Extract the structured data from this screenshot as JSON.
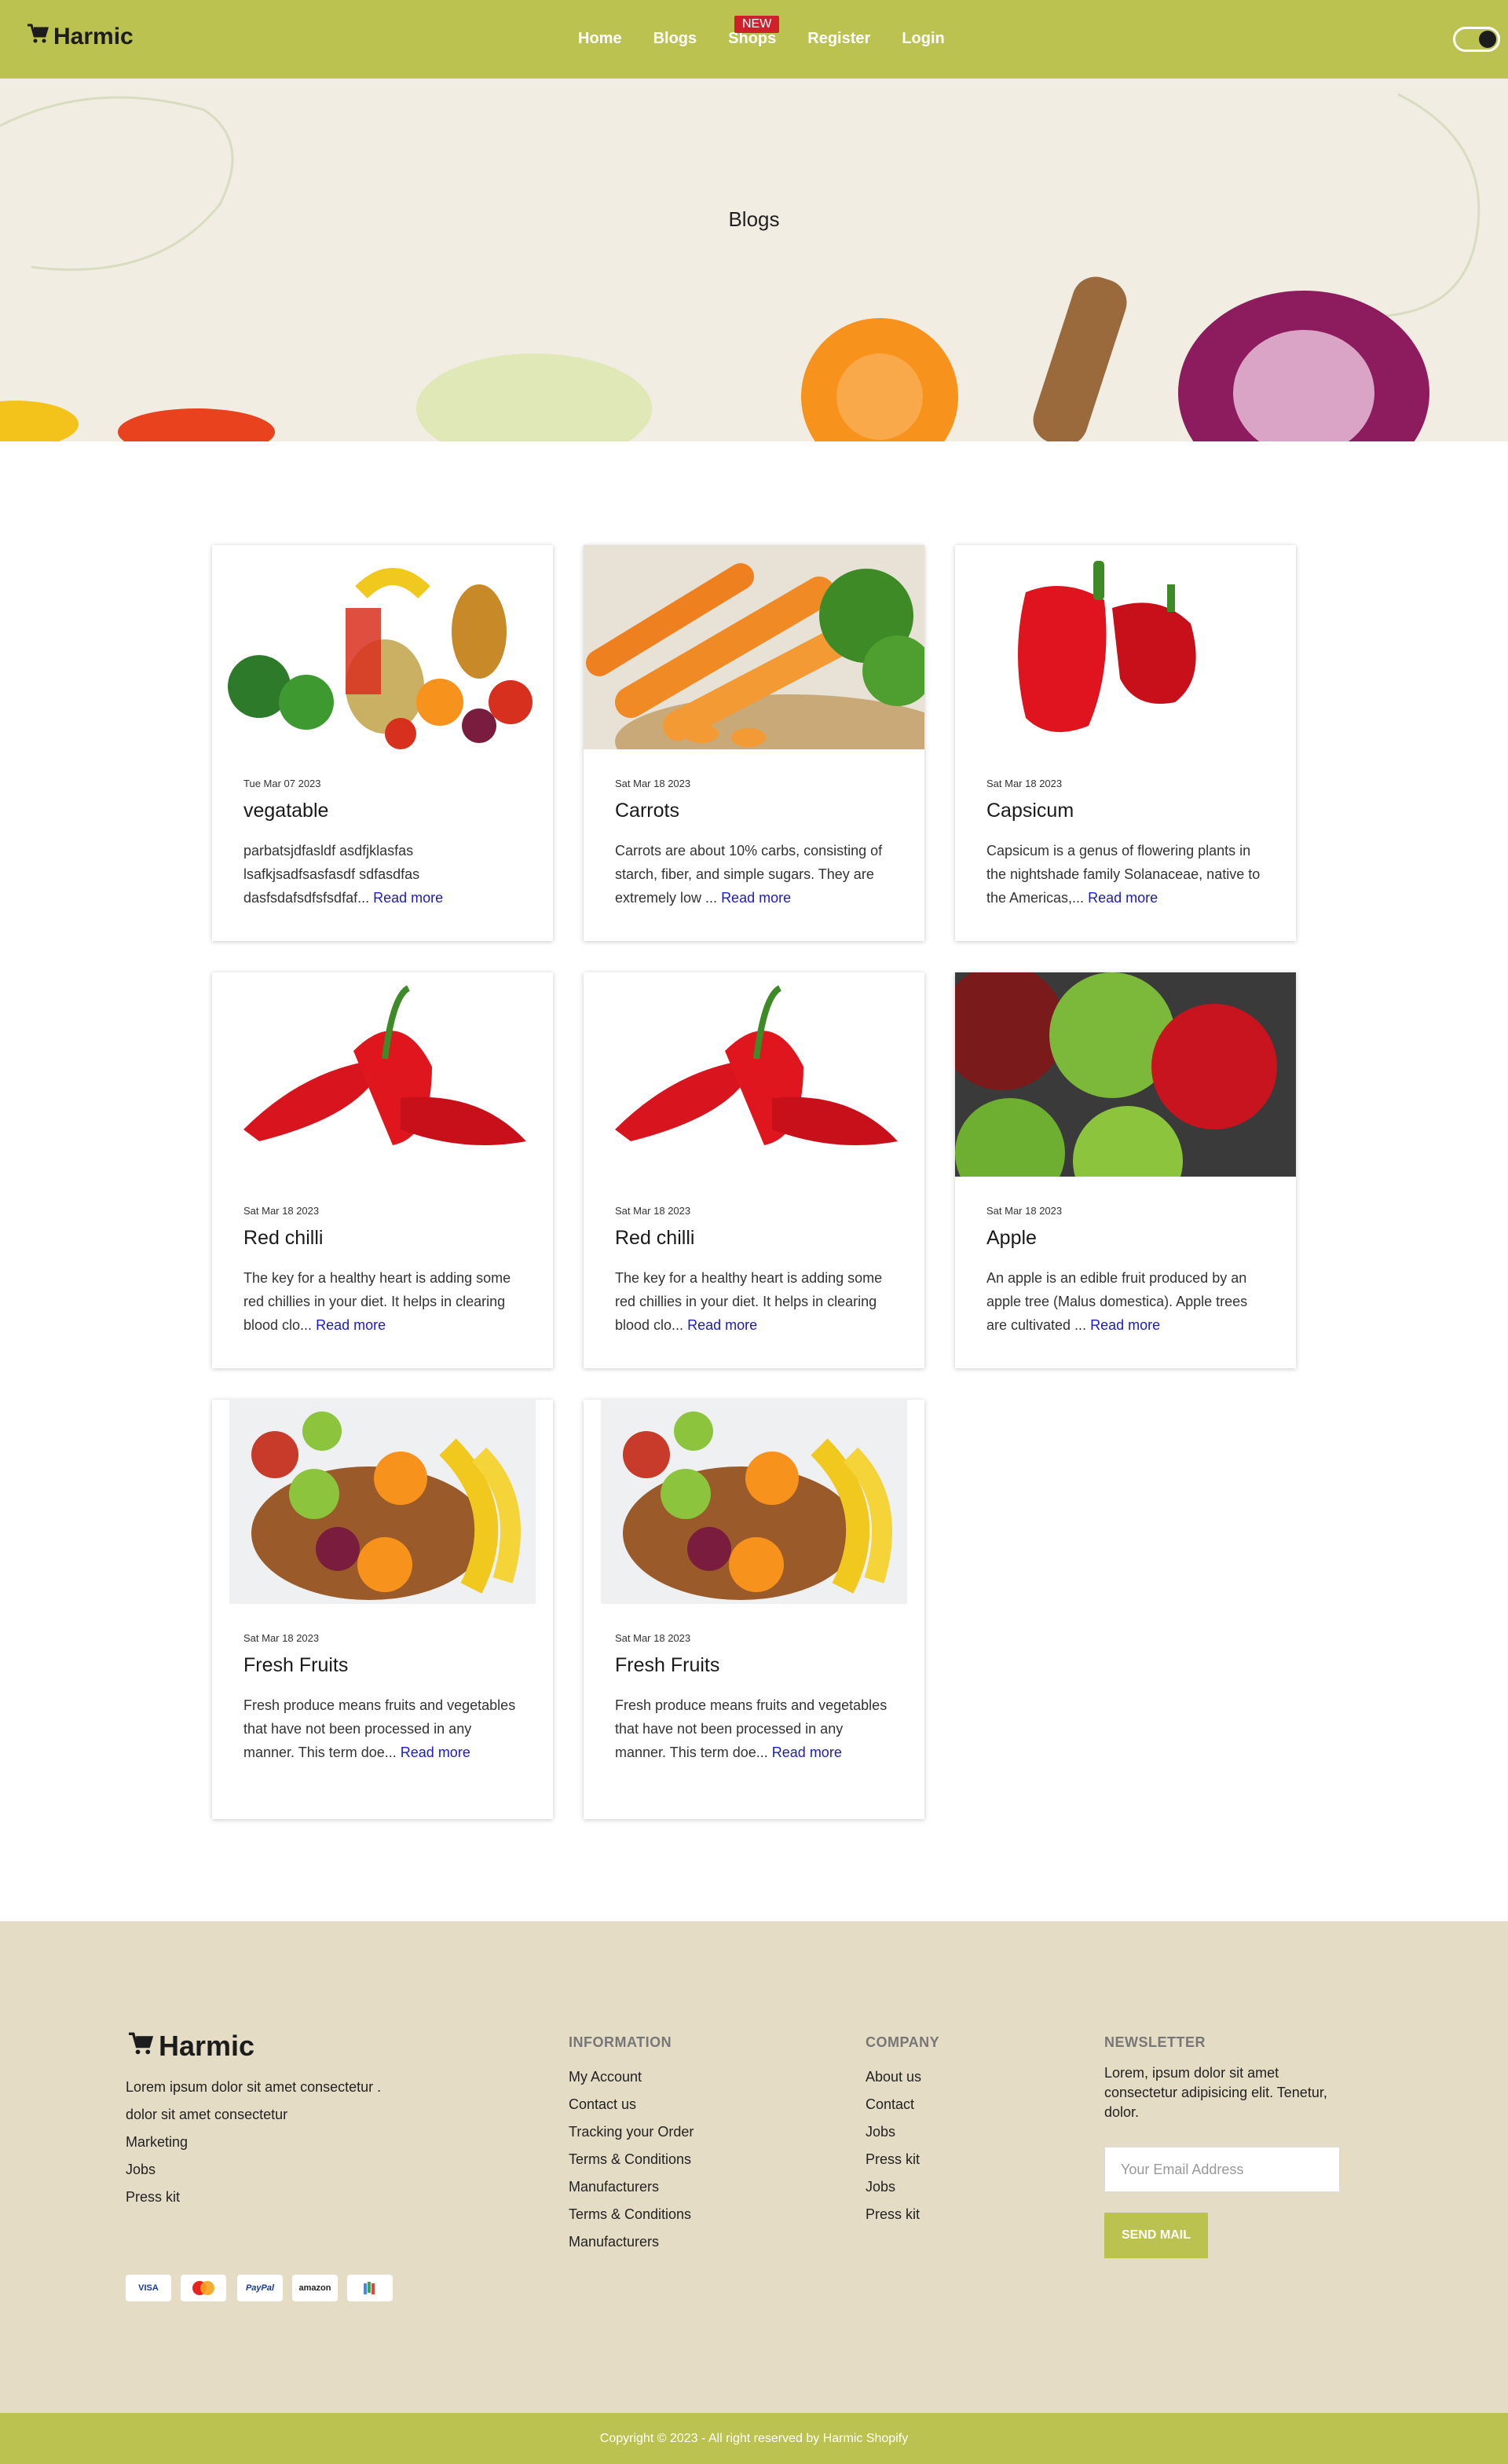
{
  "nav": {
    "brand": "Harmic",
    "links": [
      "Home",
      "Blogs",
      "Shops",
      "Register",
      "Login"
    ],
    "new_badge": "NEW",
    "accent": "#bcc24f"
  },
  "hero": {
    "title": "Blogs"
  },
  "posts": [
    {
      "date": "Tue Mar 07 2023",
      "title": "vegatable",
      "excerpt": "parbatsjdfasldf asdfjklasfas lsafkjsadfsasfasdf sdfasdfas dasfsdafsdfsfsdfaf...",
      "read_more": "Read more"
    },
    {
      "date": "Sat Mar 18 2023",
      "title": "Carrots",
      "excerpt": "Carrots are about 10% carbs, consisting of starch, fiber, and simple sugars. They are extremely low ...",
      "read_more": "Read more"
    },
    {
      "date": "Sat Mar 18 2023",
      "title": "Capsicum",
      "excerpt": "Capsicum is a genus of flowering plants in the nightshade family Solanaceae, native to the Americas,...",
      "read_more": "Read more"
    },
    {
      "date": "Sat Mar 18 2023",
      "title": "Red chilli",
      "excerpt": "The key for a healthy heart is adding some red chillies in your diet. It helps in clearing blood clo...",
      "read_more": "Read more"
    },
    {
      "date": "Sat Mar 18 2023",
      "title": "Red chilli",
      "excerpt": "The key for a healthy heart is adding some red chillies in your diet. It helps in clearing blood clo...",
      "read_more": "Read more"
    },
    {
      "date": "Sat Mar 18 2023",
      "title": "Apple",
      "excerpt": "An apple is an edible fruit produced by an apple tree (Malus domestica). Apple trees are cultivated ...",
      "read_more": "Read more"
    },
    {
      "date": "Sat Mar 18 2023",
      "title": "Fresh Fruits",
      "excerpt": "Fresh produce means fruits and vegetables that have not been processed in any manner. This term doe...",
      "read_more": "Read more"
    },
    {
      "date": "Sat Mar 18 2023",
      "title": "Fresh Fruits",
      "excerpt": "Fresh produce means fruits and vegetables that have not been processed in any manner. This term doe...",
      "read_more": "Read more"
    }
  ],
  "footer": {
    "brand": "Harmic",
    "about": [
      "Lorem ipsum dolor sit amet consectetur .",
      "dolor sit amet consectetur",
      "Marketing",
      "Jobs",
      "Press kit"
    ],
    "information": {
      "heading": "INFORMATION",
      "items": [
        "My Account",
        "Contact us",
        "Tracking your Order",
        "Terms & Conditions",
        "Manufacturers",
        "Terms & Conditions",
        "Manufacturers"
      ]
    },
    "company": {
      "heading": "COMPANY",
      "items": [
        "About us",
        "Contact",
        "Jobs",
        "Press kit",
        "Jobs",
        "Press kit"
      ]
    },
    "newsletter": {
      "heading": "NEWSLETTER",
      "text": "Lorem, ipsum dolor sit amet consectetur adipisicing elit. Tenetur, dolor.",
      "email_placeholder": "Your Email Address",
      "button": "SEND MAIL"
    },
    "payments": [
      "VISA",
      "mastercard",
      "PayPal",
      "amazon",
      "gpay"
    ],
    "copyright": "Copyright © 2023 - All right reserved by Harmic Shopify"
  }
}
